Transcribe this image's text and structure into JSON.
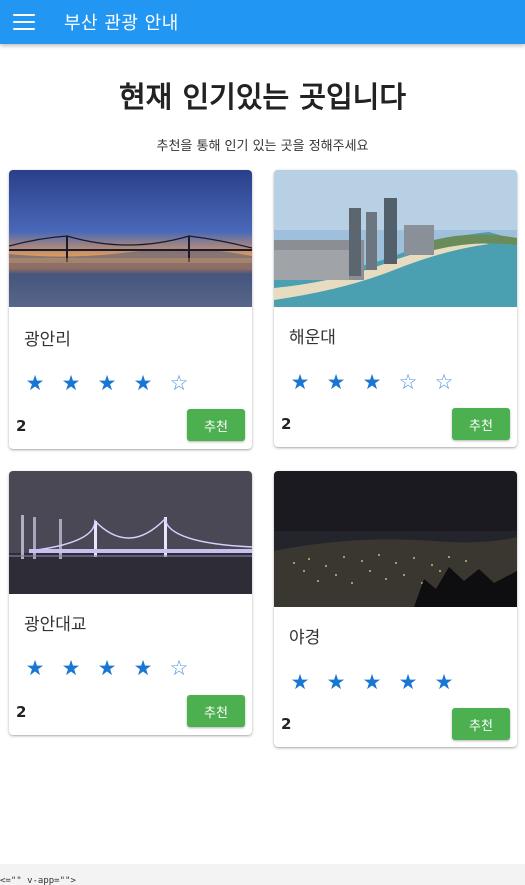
{
  "appbar": {
    "title": "부산 관광 안내",
    "menu_icon": "hamburger-menu-icon"
  },
  "main": {
    "headline": "현재 인기있는 곳입니다",
    "subtitle": "추천을 통해 인기 있는 곳을 정해주세요"
  },
  "cards": [
    {
      "title": "광안리",
      "rating": 4,
      "max_rating": 5,
      "count": "2",
      "button": "추천",
      "image": "sunset-bridge-photo"
    },
    {
      "title": "해운대",
      "rating": 3,
      "max_rating": 5,
      "count": "2",
      "button": "추천",
      "image": "haeundae-beach-city-photo"
    },
    {
      "title": "광안대교",
      "rating": 4,
      "max_rating": 5,
      "count": "2",
      "button": "추천",
      "image": "night-bridge-photo"
    },
    {
      "title": "야경",
      "rating": 5,
      "max_rating": 5,
      "count": "2",
      "button": "추천",
      "image": "city-night-view-photo"
    }
  ],
  "footer": {
    "code_fragment": "<=\"\" v-app=\"\">"
  },
  "colors": {
    "appbar": "#2196f3",
    "star": "#1976d2",
    "button": "#4caf50"
  }
}
